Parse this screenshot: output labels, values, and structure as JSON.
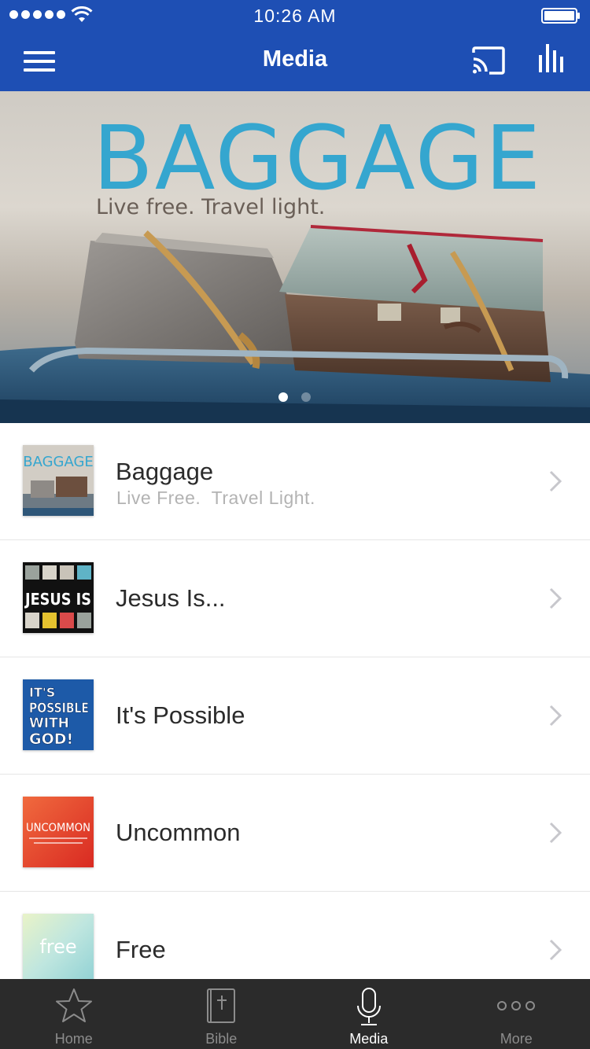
{
  "status_bar": {
    "time": "10:26 AM"
  },
  "navbar": {
    "title": "Media"
  },
  "banner": {
    "title": "BAGGAGE",
    "tagline": "Live free. Travel light.",
    "page_count": 2,
    "active_page": 1
  },
  "series": [
    {
      "title": "Baggage",
      "subtitle": "Live Free.  Travel Light.",
      "thumb": "baggage-thumb",
      "thumb_text": "BAGGAGE"
    },
    {
      "title": "Jesus Is...",
      "subtitle": "",
      "thumb": "jesus-is-thumb",
      "thumb_text": "JESUS IS"
    },
    {
      "title": "It's Possible",
      "subtitle": "",
      "thumb": "its-possible-thumb",
      "thumb_text": "IT'S POSSIBLE WITH GOD!"
    },
    {
      "title": "Uncommon",
      "subtitle": "",
      "thumb": "uncommon-thumb",
      "thumb_text": "UNCOMMON"
    },
    {
      "title": "Free",
      "subtitle": "",
      "thumb": "free-thumb",
      "thumb_text": "free"
    }
  ],
  "tabs": [
    {
      "label": "Home",
      "icon": "star-icon",
      "active": false
    },
    {
      "label": "Bible",
      "icon": "bible-icon",
      "active": false
    },
    {
      "label": "Media",
      "icon": "microphone-icon",
      "active": true
    },
    {
      "label": "More",
      "icon": "more-dots-icon",
      "active": false
    }
  ],
  "colors": {
    "nav_blue": "#1e4fb4",
    "tabbar_bg": "#2b2b2b",
    "banner_title": "#35a6cf"
  }
}
